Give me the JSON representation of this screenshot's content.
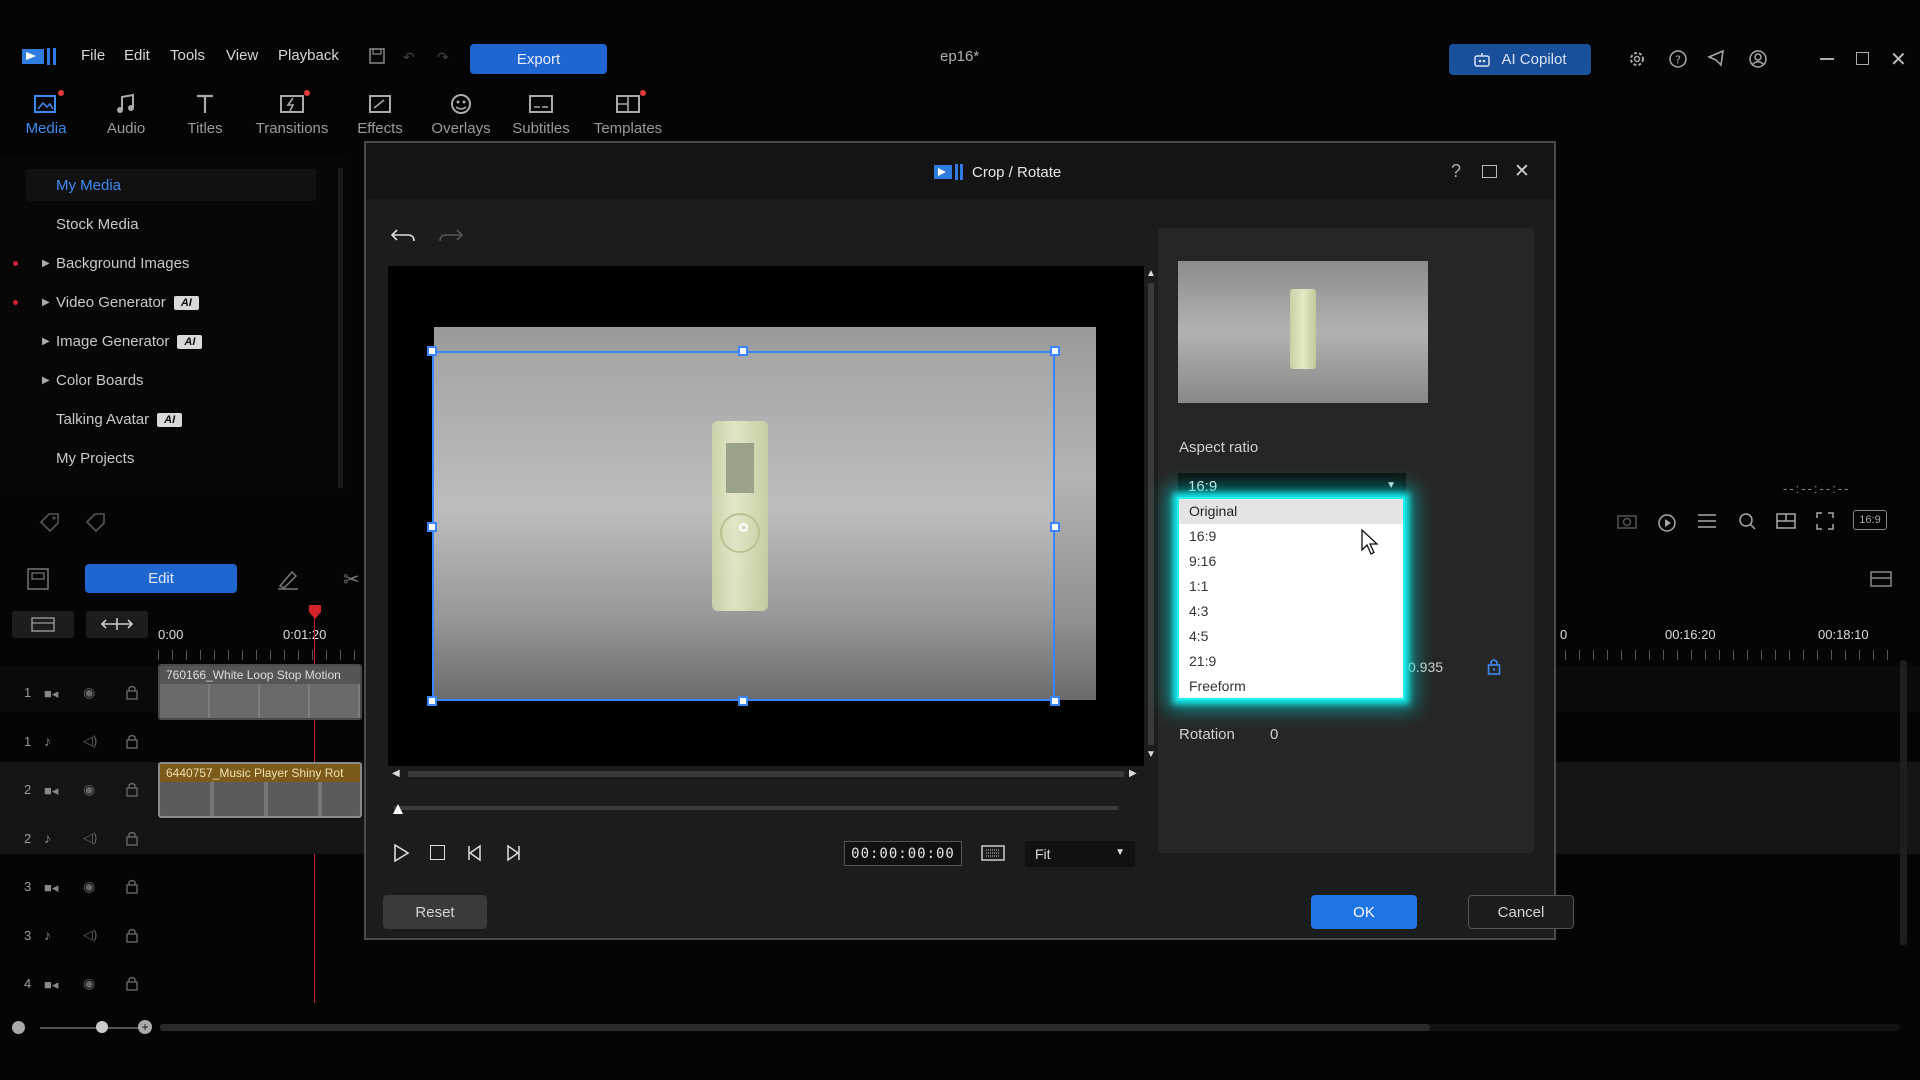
{
  "app": {
    "menu": [
      "File",
      "Edit",
      "Tools",
      "View",
      "Playback"
    ],
    "export_label": "Export",
    "doc_title": "ep16*",
    "copilot_label": "AI Copilot"
  },
  "tabs": [
    {
      "label": "Media",
      "active": true
    },
    {
      "label": "Audio"
    },
    {
      "label": "Titles"
    },
    {
      "label": "Transitions"
    },
    {
      "label": "Effects"
    },
    {
      "label": "Overlays"
    },
    {
      "label": "Subtitles"
    },
    {
      "label": "Templates"
    }
  ],
  "sidebar": {
    "items": [
      {
        "label": "My Media",
        "selected": true
      },
      {
        "label": "Stock Media"
      },
      {
        "label": "Background Images"
      },
      {
        "label": "Video Generator",
        "badge": "AI"
      },
      {
        "label": "Image Generator",
        "badge": "AI"
      },
      {
        "label": "Color Boards"
      },
      {
        "label": "Talking Avatar",
        "badge": "AI"
      },
      {
        "label": "My Projects"
      }
    ]
  },
  "timeline": {
    "edit_label": "Edit",
    "time_start": "0:00",
    "time_mark": "0:01:20",
    "time_right1": "00:16:20",
    "time_right2": "00:18:10",
    "time_right0": "0",
    "clip1": "760166_White Loop Stop Motion",
    "clip2": "6440757_Music Player Shiny Rot",
    "tracks": [
      "1",
      "1",
      "2",
      "2",
      "3",
      "3",
      "4"
    ],
    "ratio_badge": "16:9",
    "dash_time": "--:--:--:--"
  },
  "dialog": {
    "title": "Crop / Rotate",
    "timecode": "00:00:00:00",
    "fit": "Fit",
    "reset": "Reset",
    "ok": "OK",
    "cancel": "Cancel",
    "aspect_label": "Aspect ratio",
    "aspect_value": "16:9",
    "partial_value": "0.935",
    "rotation_label": "Rotation",
    "rotation_value": "0",
    "options": [
      "Original",
      "16:9",
      "9:16",
      "1:1",
      "4:3",
      "4:5",
      "21:9",
      "Freeform"
    ]
  },
  "colors": {
    "accent": "#1f66d1",
    "highlight": "#21f0f0",
    "crop_border": "#3a86ff"
  }
}
